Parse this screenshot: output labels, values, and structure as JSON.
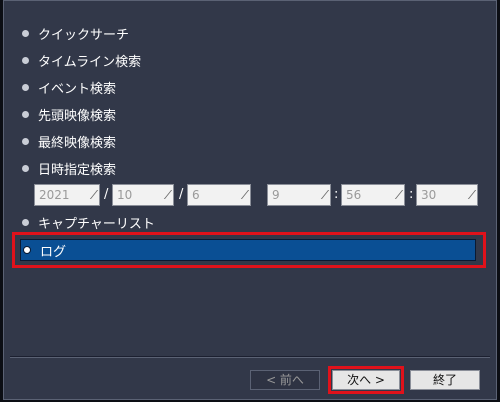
{
  "menu": {
    "items": [
      {
        "label": "クイックサーチ"
      },
      {
        "label": "タイムライン検索"
      },
      {
        "label": "イベント検索"
      },
      {
        "label": "先頭映像検索"
      },
      {
        "label": "最終映像検索"
      },
      {
        "label": "日時指定検索"
      },
      {
        "label": "キャプチャーリスト"
      },
      {
        "label": "ログ",
        "selected": true
      }
    ]
  },
  "datetime": {
    "year": "2021",
    "month": "10",
    "day": "6",
    "hour": "9",
    "minute": "56",
    "second": "30",
    "date_sep": "/",
    "time_sep": ":",
    "dropdown_mark": "⁄"
  },
  "buttons": {
    "prev_label": "< 前へ",
    "next_label": "次へ >",
    "finish_label": "終了"
  },
  "colors": {
    "panel_bg": "#323849",
    "selected_bg": "#0a4f94",
    "highlight": "#e0121b"
  }
}
